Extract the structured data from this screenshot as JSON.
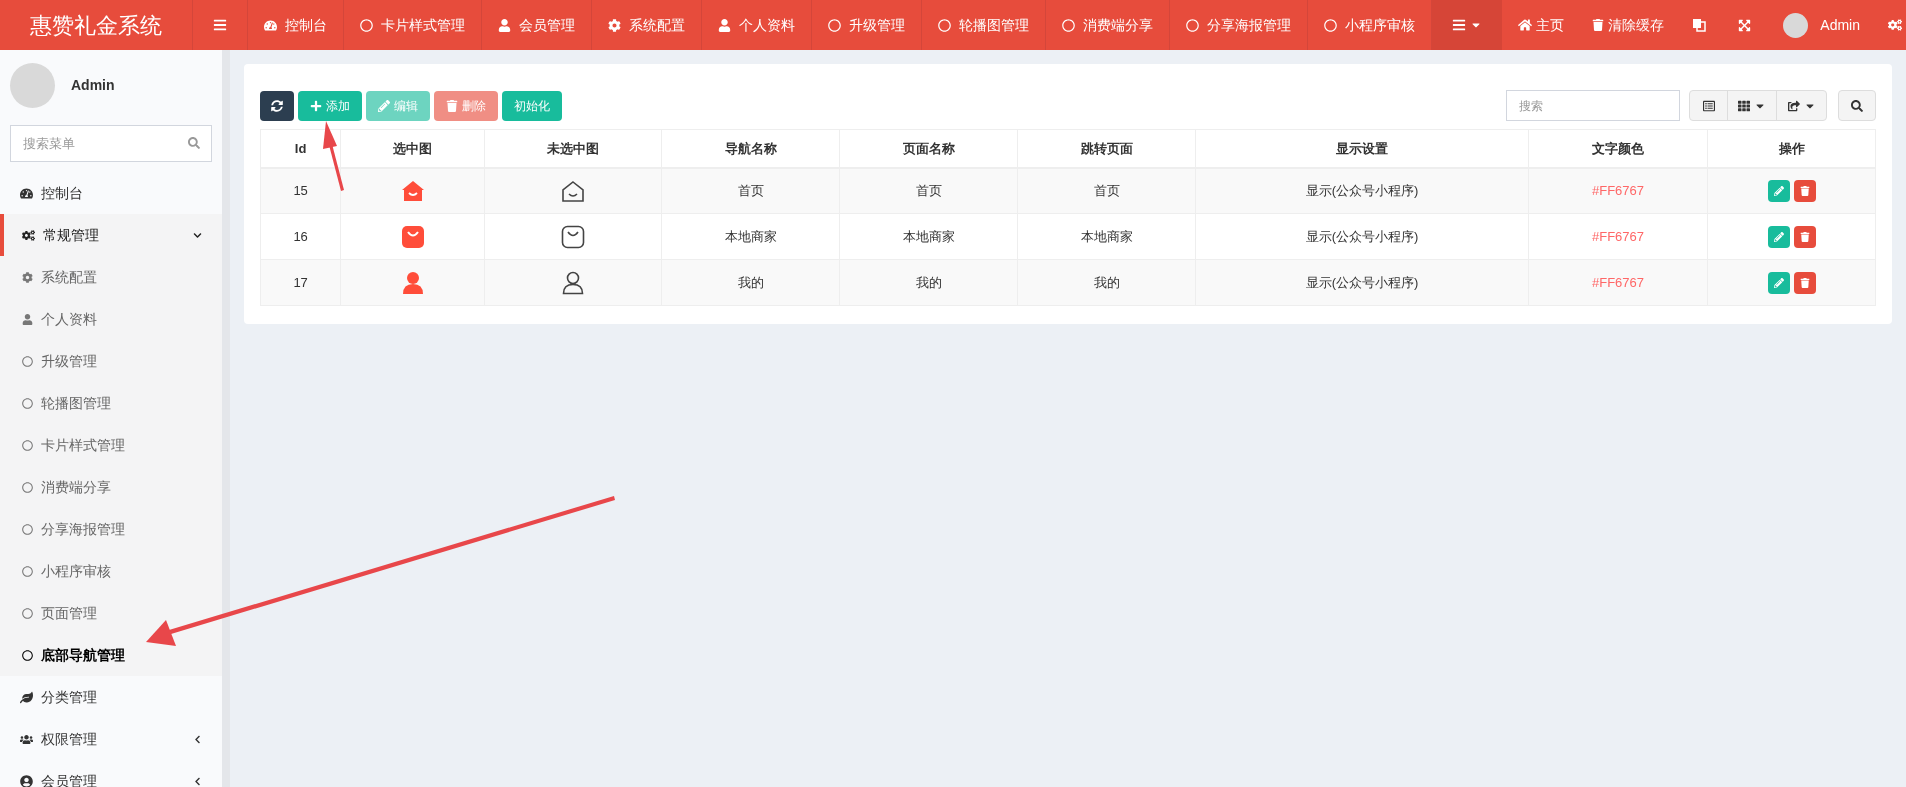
{
  "brand": "惠赞礼金系统",
  "top_nav": [
    {
      "kind": "dashboard",
      "label": "控制台"
    },
    {
      "kind": "page",
      "label": "卡片样式管理"
    },
    {
      "kind": "user",
      "label": "会员管理"
    },
    {
      "kind": "settings",
      "label": "系统配置"
    },
    {
      "kind": "user",
      "label": "个人资料"
    },
    {
      "kind": "page",
      "label": "升级管理"
    },
    {
      "kind": "page",
      "label": "轮播图管理"
    },
    {
      "kind": "page",
      "label": "消费端分享"
    },
    {
      "kind": "page",
      "label": "分享海报管理"
    },
    {
      "kind": "page",
      "label": "小程序审核"
    }
  ],
  "top_right": {
    "home": "主页",
    "clear_cache": "清除缓存",
    "user": "Admin"
  },
  "sidebar": {
    "user": "Admin",
    "search": {
      "placeholder": "搜索菜单"
    },
    "items": [
      {
        "kind": "dashboard",
        "label": "控制台"
      },
      {
        "kind": "cogs",
        "label": "常规管理",
        "expanded": true,
        "children": [
          {
            "kind": "settings",
            "label": "系统配置",
            "selected": false
          },
          {
            "kind": "user",
            "label": "个人资料",
            "selected": false
          },
          {
            "kind": "page",
            "label": "升级管理",
            "selected": false
          },
          {
            "kind": "page",
            "label": "轮播图管理",
            "selected": false
          },
          {
            "kind": "page",
            "label": "卡片样式管理",
            "selected": false
          },
          {
            "kind": "page",
            "label": "消费端分享",
            "selected": false
          },
          {
            "kind": "page",
            "label": "分享海报管理",
            "selected": false
          },
          {
            "kind": "page",
            "label": "小程序审核",
            "selected": false
          },
          {
            "kind": "page",
            "label": "页面管理",
            "selected": false
          },
          {
            "kind": "page",
            "label": "底部导航管理",
            "selected": true
          }
        ]
      },
      {
        "kind": "leaf",
        "label": "分类管理"
      },
      {
        "kind": "users",
        "label": "权限管理",
        "expanded": false
      },
      {
        "kind": "circle",
        "label": "会员管理",
        "expanded": false
      }
    ]
  },
  "toolbar": {
    "add": "添加",
    "edit": "编辑",
    "delete": "删除",
    "init": "初始化",
    "search": {
      "placeholder": "搜索"
    }
  },
  "table": {
    "columns": [
      "Id",
      "选中图",
      "未选中图",
      "导航名称",
      "页面名称",
      "跳转页面",
      "显示设置",
      "文字颜色",
      "操作"
    ],
    "rows": [
      {
        "id": "15",
        "kind": "home",
        "nav_name": "首页",
        "page_name": "首页",
        "target": "首页",
        "display": "显示(公众号小程序)",
        "text_color": "#FF6767"
      },
      {
        "id": "16",
        "kind": "bag",
        "nav_name": "本地商家",
        "page_name": "本地商家",
        "target": "本地商家",
        "display": "显示(公众号小程序)",
        "text_color": "#FF6767"
      },
      {
        "id": "17",
        "kind": "user",
        "nav_name": "我的",
        "page_name": "我的",
        "target": "我的",
        "display": "显示(公众号小程序)",
        "text_color": "#FF6767"
      }
    ]
  }
}
